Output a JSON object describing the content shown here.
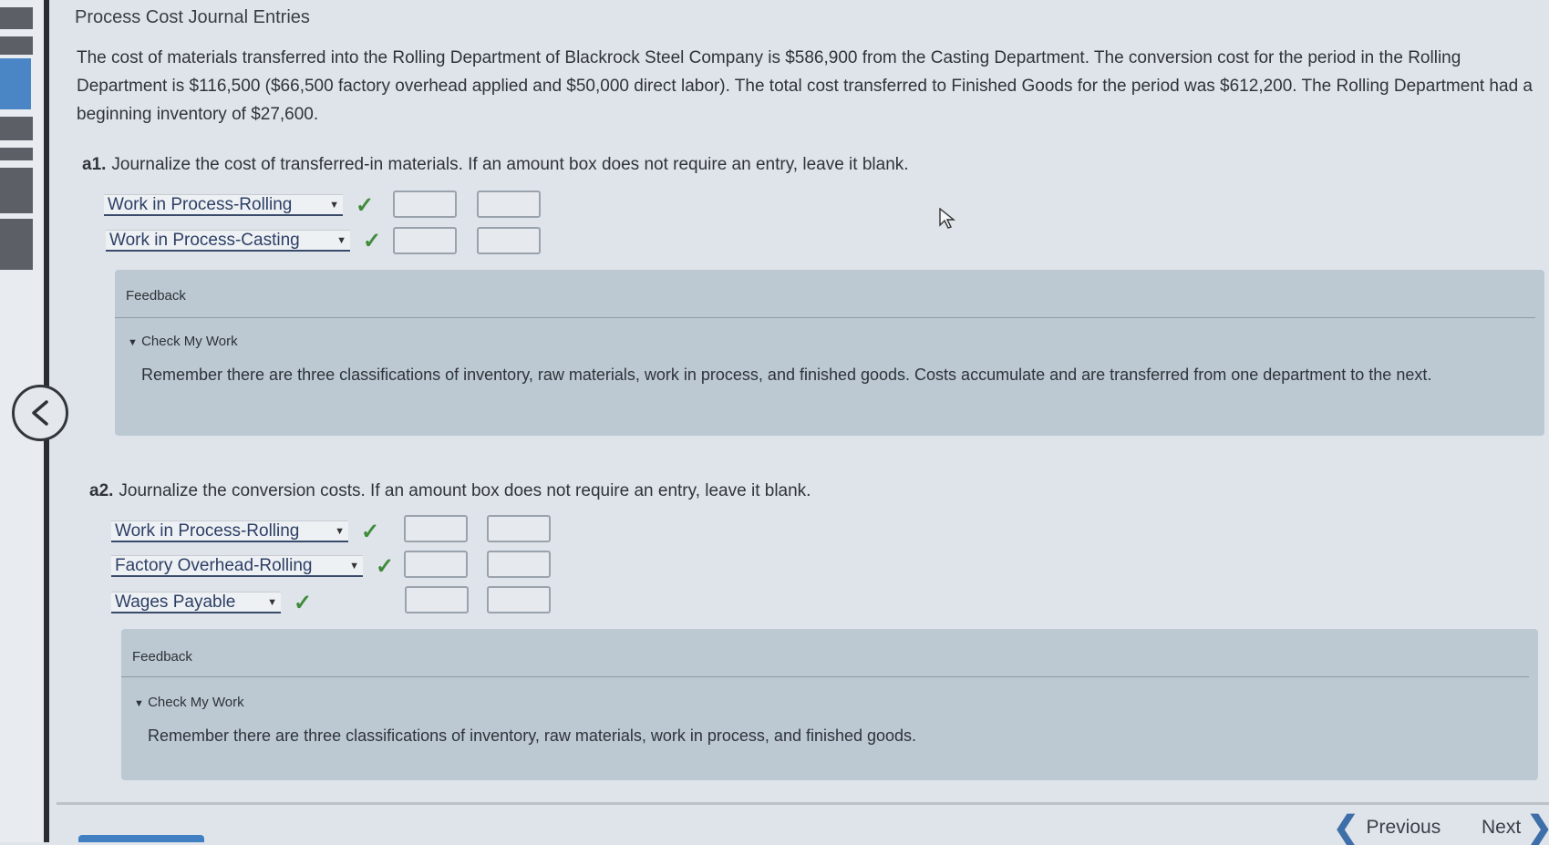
{
  "page": {
    "title": "Process Cost Journal Entries",
    "paragraph": "The cost of materials transferred into the Rolling Department of Blackrock Steel Company is $586,900 from the Casting Department. The conversion cost for the period in the Rolling Department is $116,500 ($66,500 factory overhead applied and $50,000 direct labor). The total cost transferred to Finished Goods for the period was $612,200. The Rolling Department had a beginning inventory of $27,600."
  },
  "a1": {
    "label": "a1.",
    "question": "Journalize the cost of transferred-in materials. If an amount box does not require an entry, leave it blank.",
    "rows": [
      {
        "account": "Work in Process-Rolling",
        "debit": "",
        "credit": ""
      },
      {
        "account": "Work in Process-Casting",
        "debit": "",
        "credit": ""
      }
    ],
    "feedback": {
      "title": "Feedback",
      "check_label": "Check My Work",
      "text": "Remember there are three classifications of inventory, raw materials, work in process, and finished goods. Costs accumulate and are transferred from one department to the next."
    }
  },
  "a2": {
    "label": "a2.",
    "question": "Journalize the conversion costs. If an amount box does not require an entry, leave it blank.",
    "rows": [
      {
        "account": "Work in Process-Rolling",
        "debit": "",
        "credit": ""
      },
      {
        "account": "Factory Overhead-Rolling",
        "debit": "",
        "credit": ""
      },
      {
        "account": "Wages Payable",
        "debit": "",
        "credit": ""
      }
    ],
    "feedback": {
      "title": "Feedback",
      "check_label": "Check My Work",
      "text": "Remember there are three classifications of inventory, raw materials, work in process, and finished goods."
    }
  },
  "nav": {
    "previous": "Previous",
    "next": "Next"
  },
  "icons": {
    "check": "checkmark-icon",
    "dropdown": "dropdown-arrow-icon",
    "back": "chevron-left-icon"
  },
  "colors": {
    "check": "#3f8b3a",
    "feedback_bg": "#bcc8d2",
    "accent": "#3f6fa8"
  }
}
